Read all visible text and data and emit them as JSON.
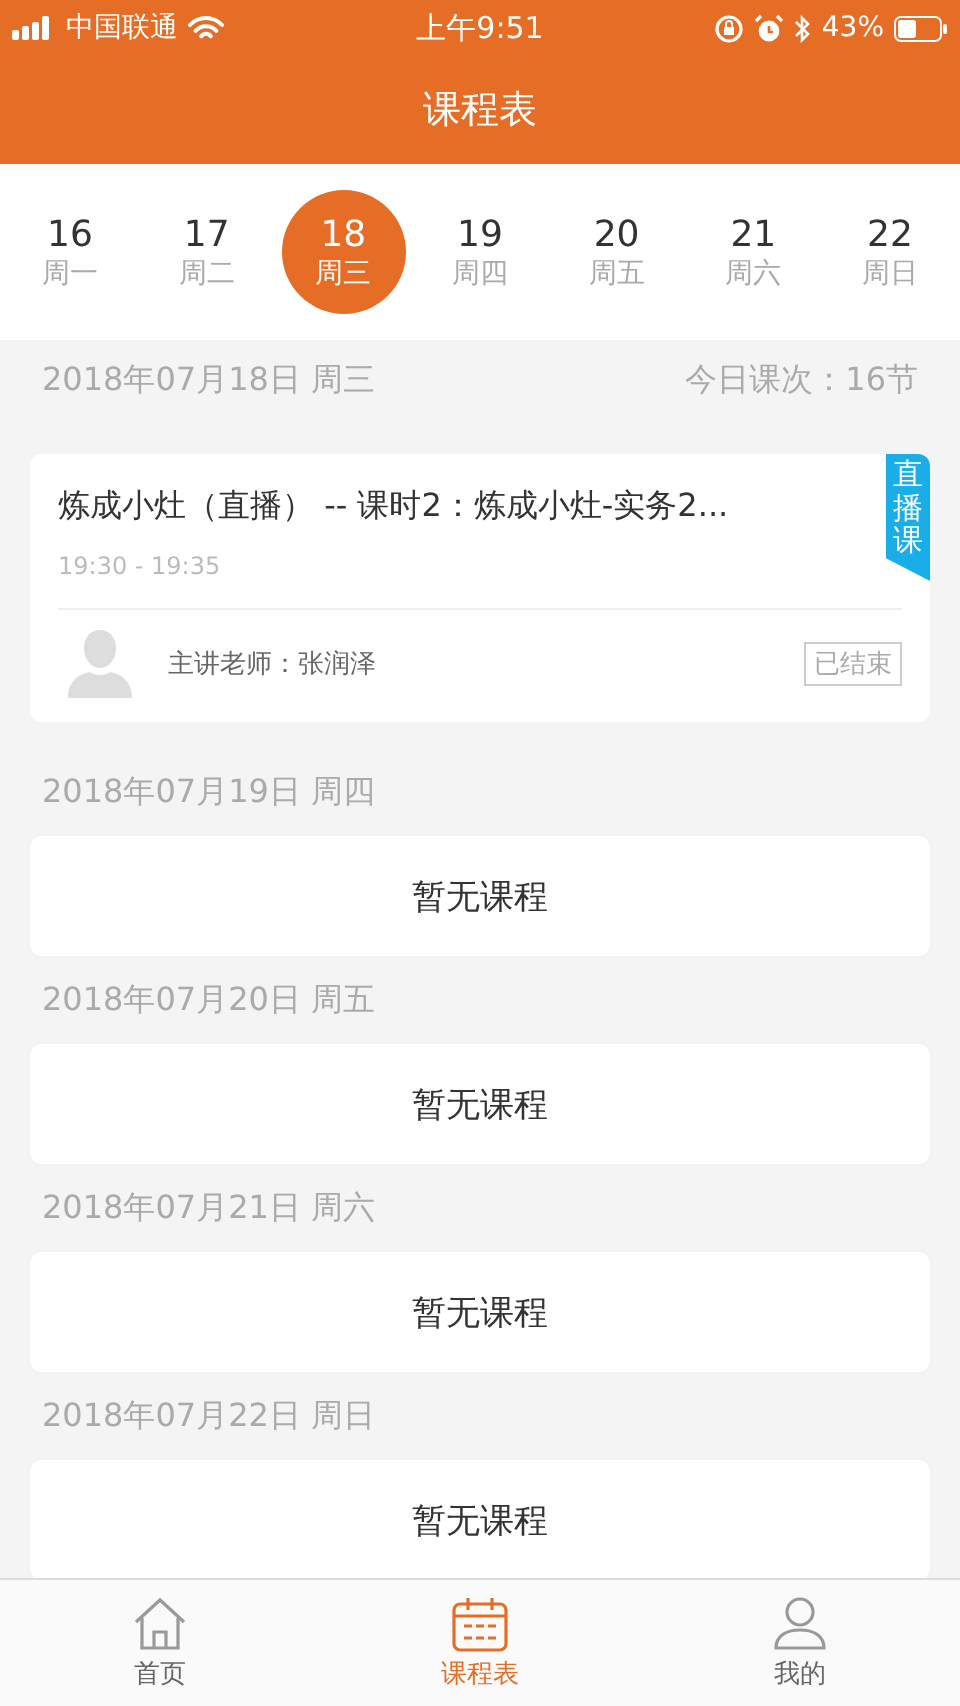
{
  "status_bar": {
    "carrier": "中国联通",
    "time": "上午9:51",
    "battery": "43%"
  },
  "title": "课程表",
  "days": [
    {
      "num": "16",
      "weekday": "周一",
      "selected": false
    },
    {
      "num": "17",
      "weekday": "周二",
      "selected": false
    },
    {
      "num": "18",
      "weekday": "周三",
      "selected": true
    },
    {
      "num": "19",
      "weekday": "周四",
      "selected": false
    },
    {
      "num": "20",
      "weekday": "周五",
      "selected": false
    },
    {
      "num": "21",
      "weekday": "周六",
      "selected": false
    },
    {
      "num": "22",
      "weekday": "周日",
      "selected": false
    }
  ],
  "sections": [
    {
      "date": "2018年07月18日  周三",
      "count": "今日课次：16节",
      "items": [
        {
          "kind": "lesson",
          "title": "炼成小灶（直播） --  课时2：炼成小灶-实务2...",
          "time": "19:30 - 19:35",
          "teacher": "主讲老师：张润泽",
          "status": "已结束",
          "ribbon": "直播课"
        }
      ]
    },
    {
      "date": "2018年07月19日  周四",
      "items": [
        {
          "kind": "empty",
          "text": "暂无课程"
        }
      ]
    },
    {
      "date": "2018年07月20日  周五",
      "items": [
        {
          "kind": "empty",
          "text": "暂无课程"
        }
      ]
    },
    {
      "date": "2018年07月21日  周六",
      "items": [
        {
          "kind": "empty",
          "text": "暂无课程"
        }
      ]
    },
    {
      "date": "2018年07月22日  周日",
      "items": [
        {
          "kind": "empty",
          "text": "暂无课程"
        }
      ]
    }
  ],
  "tabs": [
    {
      "kind": "home",
      "label": "首页",
      "selected": false
    },
    {
      "kind": "calendar",
      "label": "课程表",
      "selected": true
    },
    {
      "kind": "user",
      "label": "我的",
      "selected": false
    }
  ]
}
